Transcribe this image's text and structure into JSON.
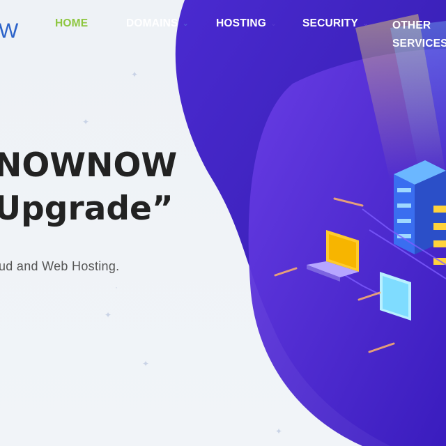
{
  "brand": {
    "logo_text_visible": "W",
    "logo_color": "#2c63c9"
  },
  "nav": {
    "items": [
      {
        "label": "HOME",
        "active": true,
        "has_dropdown": false
      },
      {
        "label": "DOMAINS",
        "has_dropdown": true
      },
      {
        "label": "HOSTING",
        "has_dropdown": true
      },
      {
        "label": "SECURITY",
        "has_dropdown": true
      },
      {
        "label": "OTHER SERVICES",
        "has_dropdown": false
      }
    ],
    "active_color": "#8dc63f"
  },
  "hero": {
    "headline_line1": "NOWNOW",
    "headline_line2": "Upgrade”",
    "subtitle": "ud and Web Hosting."
  },
  "colors": {
    "blob_dark": "#3b1fb8",
    "blob_mid": "#5a30d9",
    "blob_light": "#7a4bf0",
    "server_cyan": "#4aa3ff",
    "server_yellow": "#ffd23c"
  },
  "icons": [
    "chevron-down-icon",
    "server-rack-illustration",
    "laptop-illustration",
    "monitor-illustration"
  ]
}
